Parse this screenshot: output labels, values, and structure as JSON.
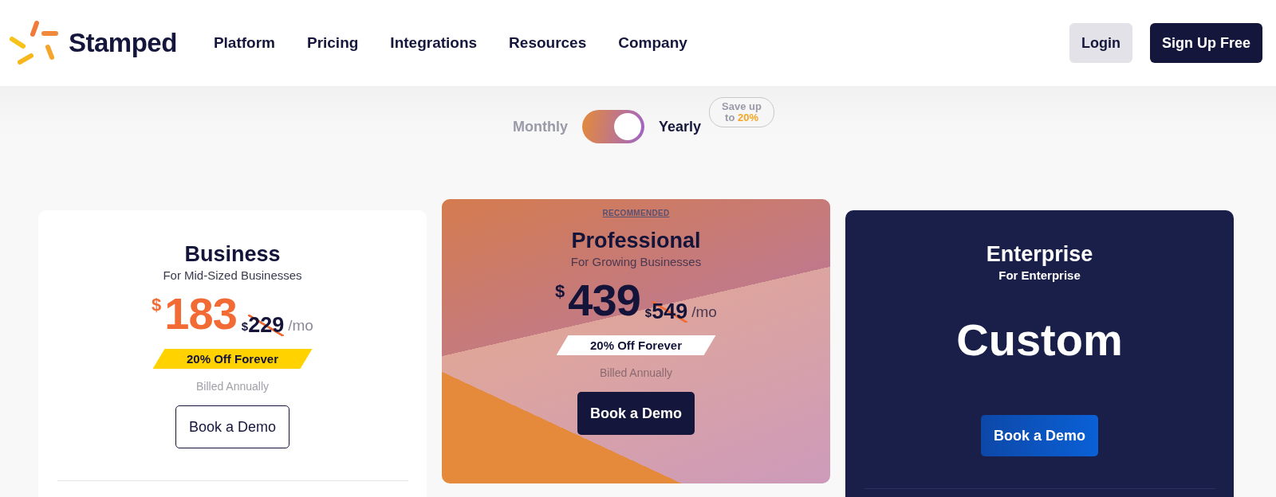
{
  "header": {
    "brand": "Stamped",
    "nav": [
      "Platform",
      "Pricing",
      "Integrations",
      "Resources",
      "Company"
    ],
    "actions": [
      {
        "label": "Login",
        "kind": "secondary"
      },
      {
        "label": "Sign Up Free",
        "kind": "primary"
      }
    ]
  },
  "billing": {
    "options": [
      {
        "label": "Monthly",
        "selected": false
      },
      {
        "label": "Yearly",
        "selected": true
      }
    ],
    "save_badge": "Save up to **20%**"
  },
  "plans": [
    {
      "kind": "discount",
      "name": "Business",
      "subtitle": "For Mid-Sized Businesses",
      "currency": "$",
      "price": "183",
      "old_currency": "$",
      "old_price": "229",
      "period": "/mo",
      "promo": "20% Off Forever",
      "note": "Billed Annually",
      "button": "Book a Demo"
    },
    {
      "kind": "discount",
      "badge": "RECOMMENDED",
      "name": "Professional",
      "subtitle": "For Growing Businesses",
      "currency": "$",
      "price": "439",
      "old_currency": "$",
      "old_price": "549",
      "period": "/mo",
      "promo": "20% Off Forever",
      "note": "Billed Annually",
      "button": "Book a Demo"
    },
    {
      "kind": "custom",
      "name": "Enterprise",
      "subtitle": "For Enterprise",
      "price": "Custom",
      "button": "Book a Demo"
    }
  ]
}
